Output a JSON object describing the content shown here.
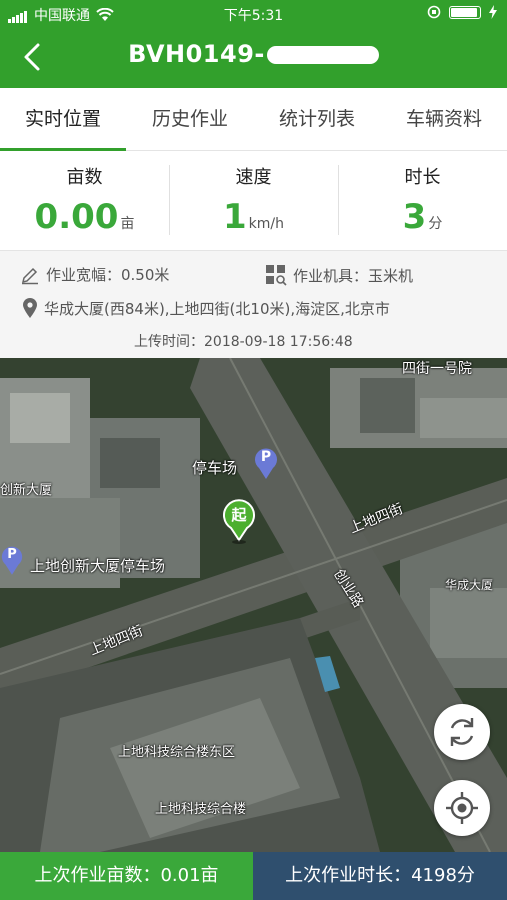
{
  "status": {
    "carrier": "中国联通",
    "time": "下午5:31"
  },
  "nav": {
    "title": "BVH0149-"
  },
  "tabs": [
    {
      "label": "实时位置"
    },
    {
      "label": "历史作业"
    },
    {
      "label": "统计列表"
    },
    {
      "label": "车辆资料"
    }
  ],
  "stats": {
    "area": {
      "label": "亩数",
      "value": "0.00",
      "unit": "亩"
    },
    "speed": {
      "label": "速度",
      "value": "1",
      "unit": "km/h"
    },
    "duration": {
      "label": "时长",
      "value": "3",
      "unit": "分"
    }
  },
  "info": {
    "width": "作业宽幅：0.50米",
    "tool": "作业机具：玉米机",
    "address": "华成大厦(西84米),上地四街(北10米),海淀区,北京市",
    "upload_time": "上传时间：2018-09-18 17:56:48"
  },
  "map": {
    "labels": {
      "l1": "四街一号院",
      "l2": "停车场",
      "l3": "创新大厦",
      "l4": "上地创新大厦停车场",
      "l5": "上地四街",
      "l6": "创业路",
      "l7": "华成大厦",
      "l8": "上地四街",
      "l9": "上地科技综合楼东区",
      "l10": "上地科技综合楼"
    },
    "start_marker": "起",
    "parking_marker": "P"
  },
  "bottom": {
    "last_area": "上次作业亩数：0.01亩",
    "last_duration": "上次作业时长：4198分"
  },
  "colors": {
    "brand_green": "#32a02c",
    "value_green": "#3aa83a",
    "bottom_blue": "#2f4f6e"
  }
}
